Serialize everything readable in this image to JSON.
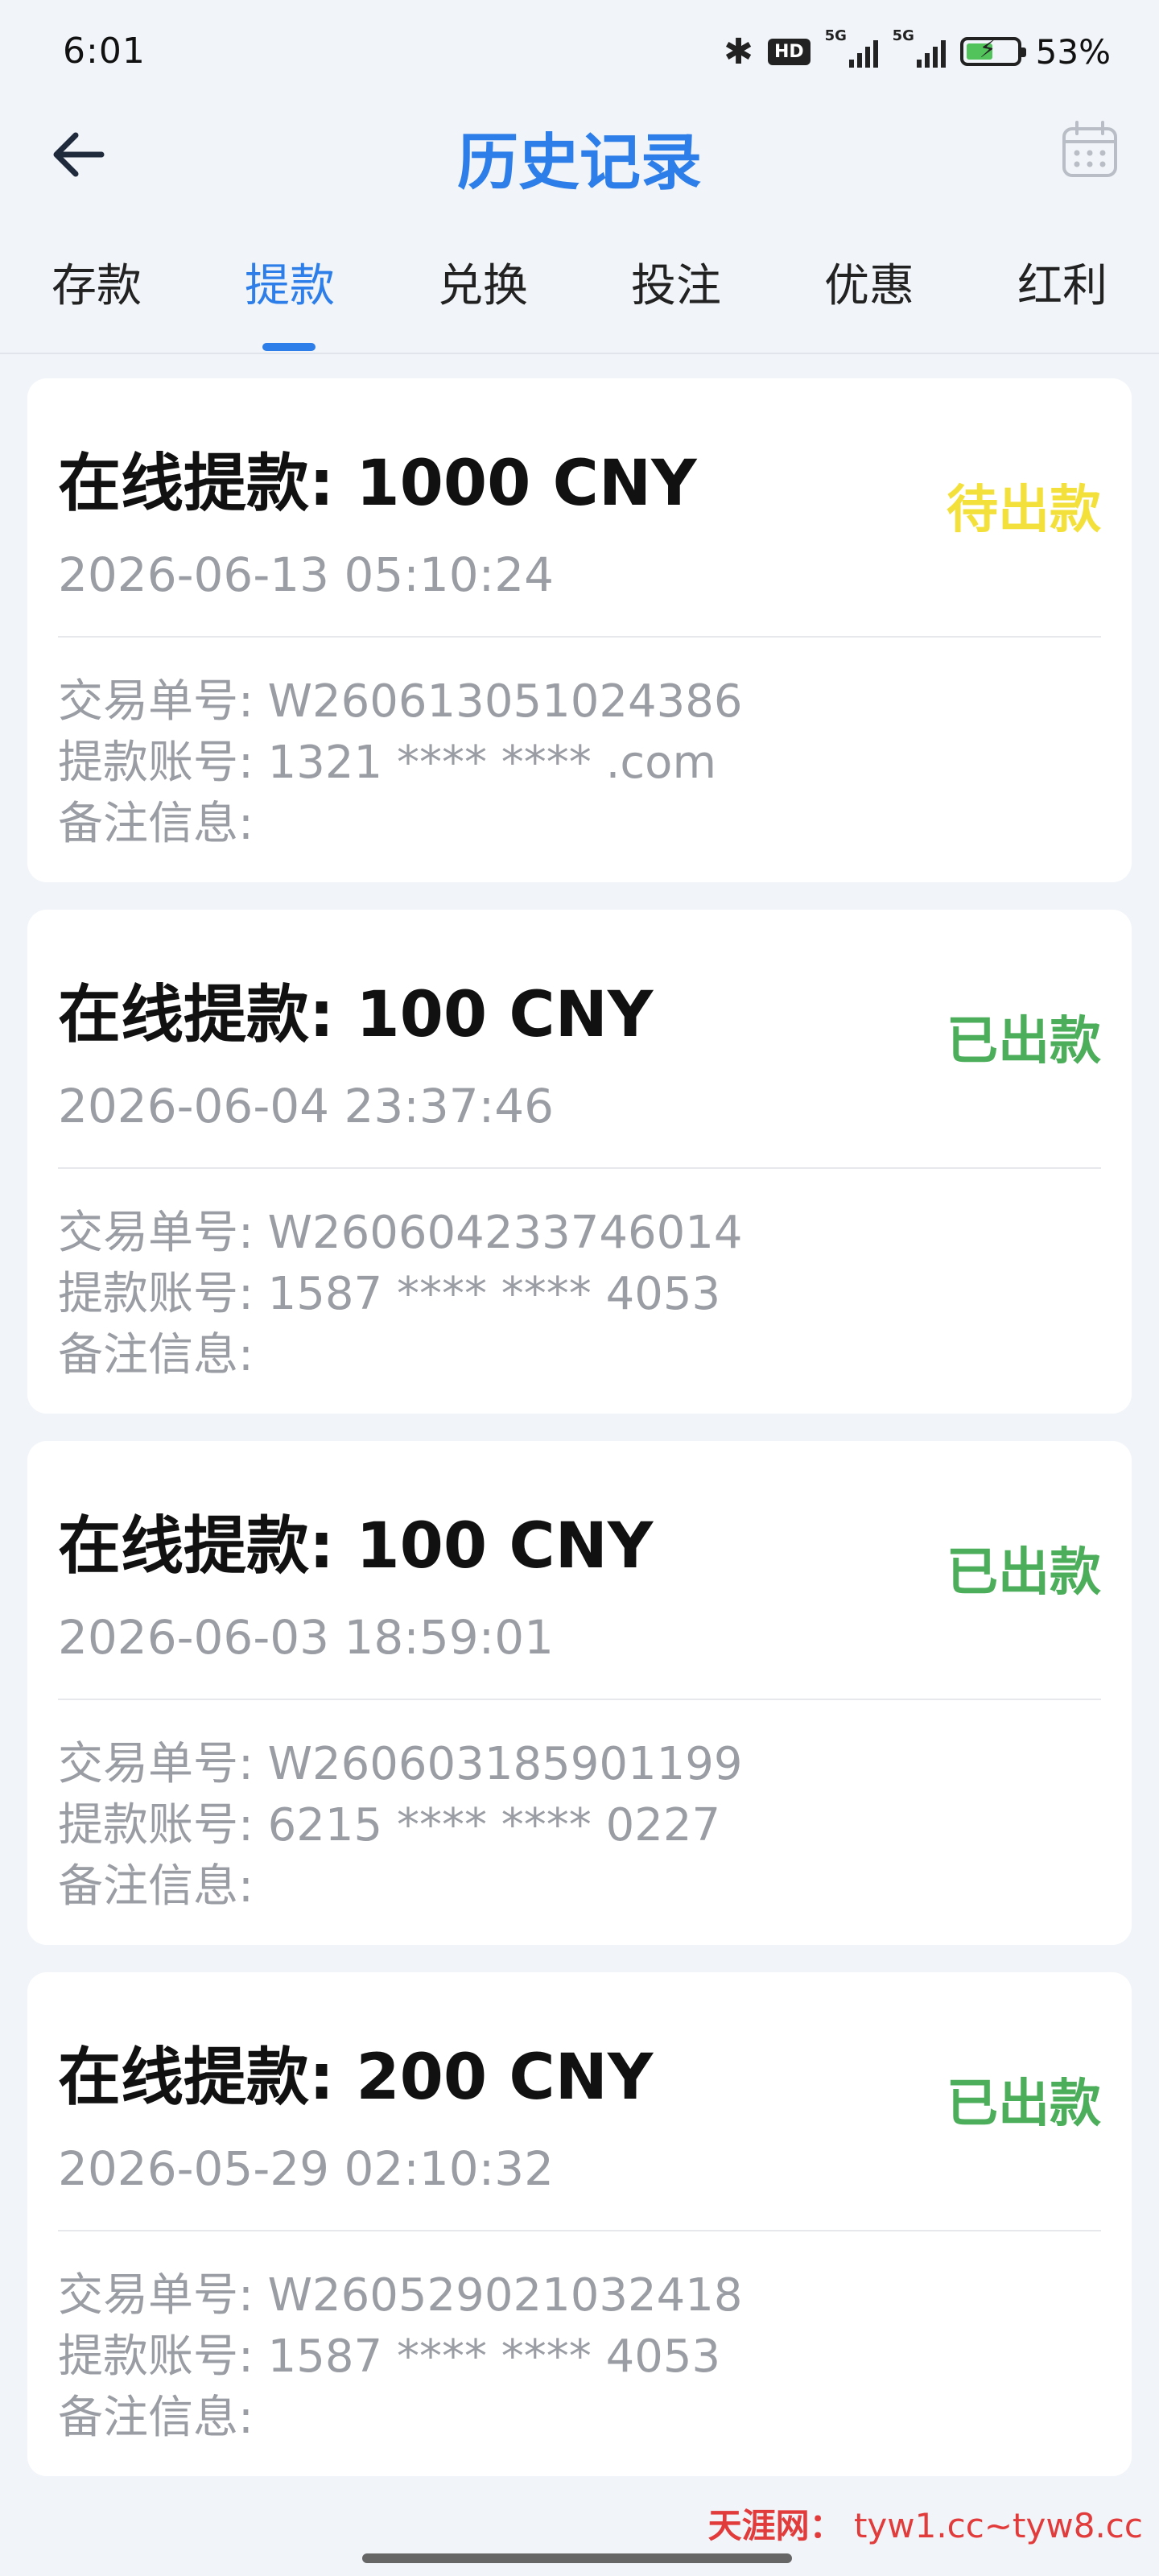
{
  "status_bar": {
    "time": "6:01",
    "hd_label": "HD",
    "signal_1_label": "5G",
    "signal_2_label": "5G",
    "battery_percent": "53%",
    "battery_level": 0.53,
    "bluetooth_icon": "bluetooth-icon"
  },
  "header": {
    "title": "历史记录",
    "back_icon": "arrow-left-icon",
    "calendar_icon": "calendar-icon"
  },
  "tabs": [
    {
      "label": "存款",
      "active": false
    },
    {
      "label": "提款",
      "active": true
    },
    {
      "label": "兑换",
      "active": false
    },
    {
      "label": "投注",
      "active": false
    },
    {
      "label": "优惠",
      "active": false
    },
    {
      "label": "红利",
      "active": false
    }
  ],
  "colors": {
    "accent": "#2d7ee8",
    "pending": "#f3e03a",
    "paid": "#4cae5a",
    "watermark": "#e23b3b"
  },
  "records": [
    {
      "title": "在线提款: 1000 CNY",
      "status": "待出款",
      "status_type": "pending",
      "time": "2026-06-13 05:10:24",
      "order_line": "交易单号: W260613051024386",
      "account_line": "提款账号: 1321 **** **** .com",
      "note_line": "备注信息:"
    },
    {
      "title": "在线提款: 100 CNY",
      "status": "已出款",
      "status_type": "paid",
      "time": "2026-06-04 23:37:46",
      "order_line": "交易单号: W260604233746014",
      "account_line": "提款账号: 1587 **** **** 4053",
      "note_line": "备注信息:"
    },
    {
      "title": "在线提款: 100 CNY",
      "status": "已出款",
      "status_type": "paid",
      "time": "2026-06-03 18:59:01",
      "order_line": "交易单号: W260603185901199",
      "account_line": "提款账号: 6215 **** **** 0227",
      "note_line": "备注信息:"
    },
    {
      "title": "在线提款: 200 CNY",
      "status": "已出款",
      "status_type": "paid",
      "time": "2026-05-29 02:10:32",
      "order_line": "交易单号: W260529021032418",
      "account_line": "提款账号: 1587 **** **** 4053",
      "note_line": "备注信息:"
    }
  ],
  "watermark": {
    "brand": "天涯网：",
    "text": "tyw1.cc~tyw8.cc"
  }
}
